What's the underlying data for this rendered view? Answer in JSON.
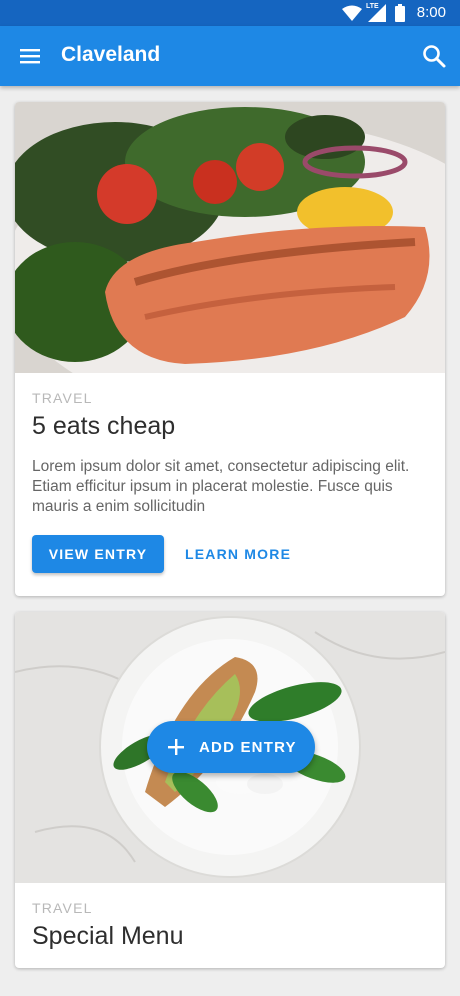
{
  "status_bar": {
    "network_label": "LTE",
    "time": "8:00",
    "icons": [
      "wifi-icon",
      "cell-signal-icon",
      "battery-icon"
    ]
  },
  "app_bar": {
    "title": "Claveland",
    "menu_icon": "menu-icon",
    "search_icon": "search-icon"
  },
  "cards": [
    {
      "image": "grilled-salmon-salad-photo",
      "category": "TRAVEL",
      "title": "5 eats cheap",
      "description": "Lorem ipsum dolor sit amet, consectetur adipiscing elit. Etiam efficitur ipsum in placerat molestie.  Fusce quis mauris a enim sollicitudin",
      "primary_action": "VIEW ENTRY",
      "secondary_action": "LEARN MORE"
    },
    {
      "image": "avocado-toast-plate-photo",
      "category": "TRAVEL",
      "title": "Special Menu"
    }
  ],
  "fab": {
    "label": "ADD ENTRY",
    "icon": "plus-icon"
  },
  "colors": {
    "status_bar": "#1565c0",
    "app_bar": "#1e88e5",
    "accent": "#1e88e5",
    "background": "#eeeeee"
  }
}
